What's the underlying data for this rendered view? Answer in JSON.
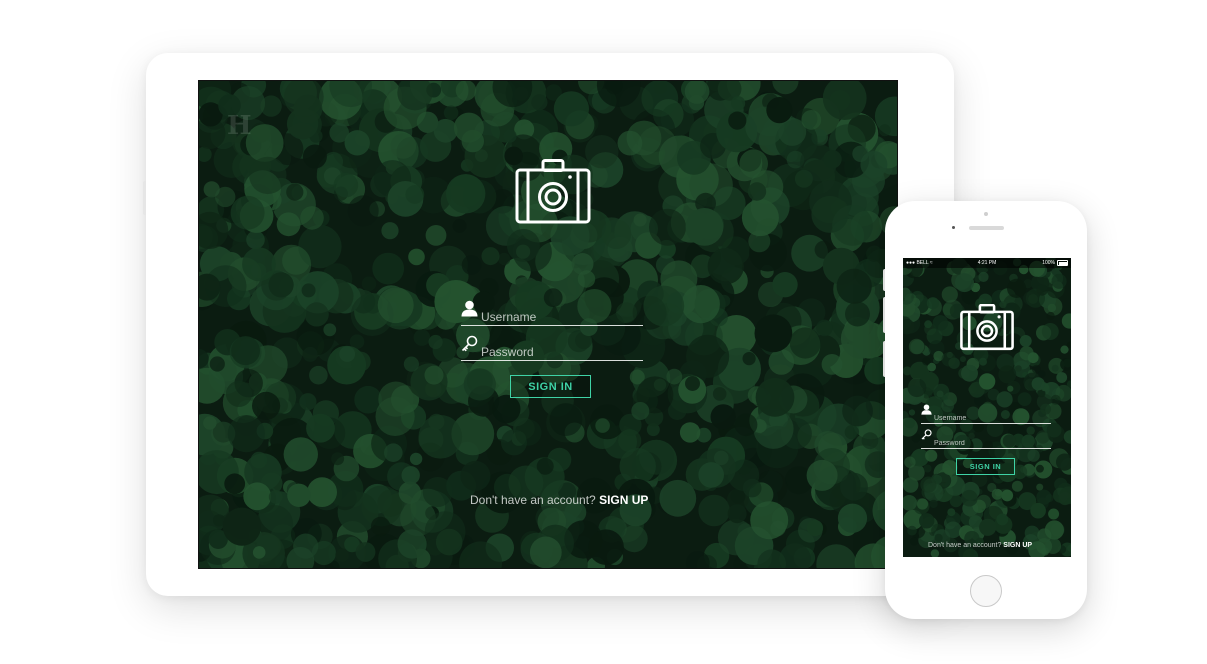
{
  "app": {
    "brand": "H"
  },
  "login": {
    "username_placeholder": "Username",
    "password_placeholder": "Password",
    "signin_label": "SIGN IN",
    "signup_prompt": "Don't have an account?",
    "signup_link": "SIGN UP"
  },
  "statusbar": {
    "carrier": "BELL",
    "time": "4:21 PM",
    "battery": "100%"
  },
  "colors": {
    "accent": "#3fd3a6",
    "forest_dark": "#0f2417",
    "forest_mid": "#1f4a2c"
  },
  "icons": {
    "logo": "camera-icon",
    "username": "user-icon",
    "password": "key-icon"
  }
}
